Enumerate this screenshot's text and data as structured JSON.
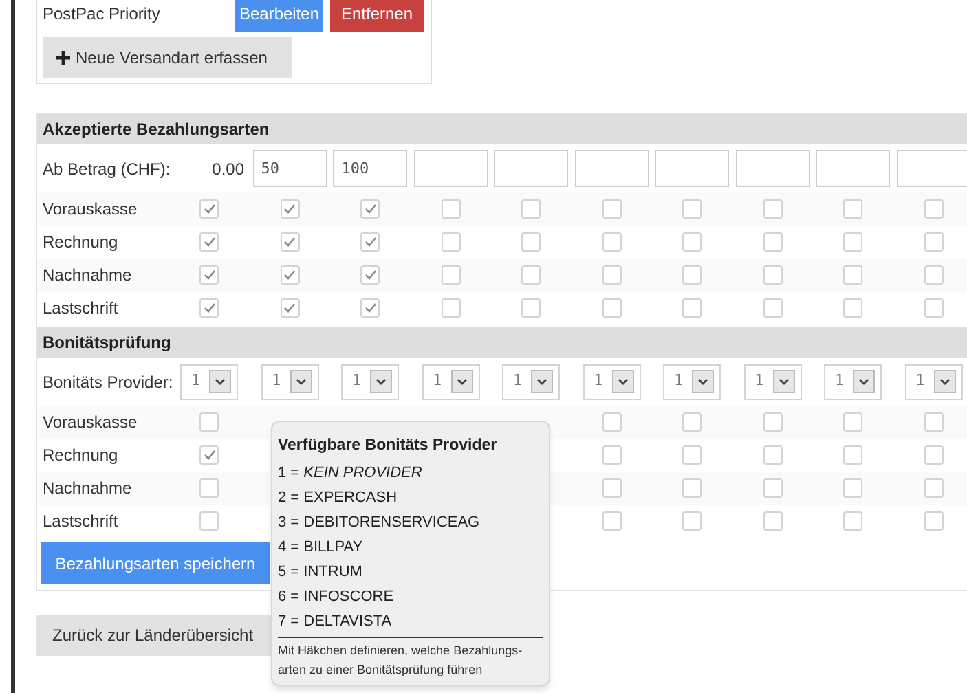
{
  "shipping": {
    "method": "PostPac Priority",
    "edit_button": "Bearbeiten",
    "remove_button": "Entfernen",
    "add_button": "Neue Versandart erfassen"
  },
  "payment": {
    "title": "Akzeptierte Bezahlungsarten",
    "amount_label": "Ab Betrag (CHF):",
    "base_amount": "0.00",
    "amounts": [
      {
        "kind": "filled",
        "value": "50"
      },
      {
        "kind": "filled",
        "value": "100"
      },
      {
        "kind": "empty"
      },
      {
        "kind": "empty"
      },
      {
        "kind": "empty"
      },
      {
        "kind": "empty"
      },
      {
        "kind": "empty"
      },
      {
        "kind": "empty"
      },
      {
        "kind": "empty"
      }
    ],
    "rows": [
      {
        "label": "Vorauskasse",
        "checks": [
          true,
          true,
          true,
          false,
          false,
          false,
          false,
          false,
          false,
          false
        ]
      },
      {
        "label": "Rechnung",
        "checks": [
          true,
          true,
          true,
          false,
          false,
          false,
          false,
          false,
          false,
          false
        ]
      },
      {
        "label": "Nachnahme",
        "checks": [
          true,
          true,
          true,
          false,
          false,
          false,
          false,
          false,
          false,
          false
        ]
      },
      {
        "label": "Lastschrift",
        "checks": [
          true,
          true,
          true,
          false,
          false,
          false,
          false,
          false,
          false,
          false
        ]
      }
    ]
  },
  "credit_check": {
    "title": "Bonitätsprüfung",
    "provider_label": "Bonitäts Provider:",
    "providers": [
      "1",
      "1",
      "1",
      "1",
      "1",
      "1",
      "1",
      "1",
      "1",
      "1"
    ],
    "rows": [
      {
        "label": "Vorauskasse",
        "checks_left": [
          false
        ],
        "checks_right": [
          false,
          false,
          false,
          false,
          false
        ]
      },
      {
        "label": "Rechnung",
        "checks_left": [
          true
        ],
        "checks_right": [
          false,
          false,
          false,
          false,
          false
        ]
      },
      {
        "label": "Nachnahme",
        "checks_left": [
          false
        ],
        "checks_right": [
          false,
          false,
          false,
          false,
          false
        ]
      },
      {
        "label": "Lastschrift",
        "checks_left": [
          false
        ],
        "checks_right": [
          false,
          false,
          false,
          false,
          false
        ]
      }
    ],
    "save_button": "Bezahlungsarten speichern"
  },
  "back_button": "Zurück zur Länderübersicht",
  "tooltip": {
    "title": "Verfügbare Bonitäts Provider",
    "items": [
      "1 = *KEIN PROVIDER*",
      "2 = EXPERCASH",
      "3 = DEBITORENSERVICEAG",
      "4 = BILLPAY",
      "5 = INTRUM",
      "6 = INFOSCORE",
      "7 = DELTAVISTA"
    ],
    "note": "Mit Häkchen definieren, welche Bezahlungs-arten zu einer Bonitätsprüfung führen"
  }
}
